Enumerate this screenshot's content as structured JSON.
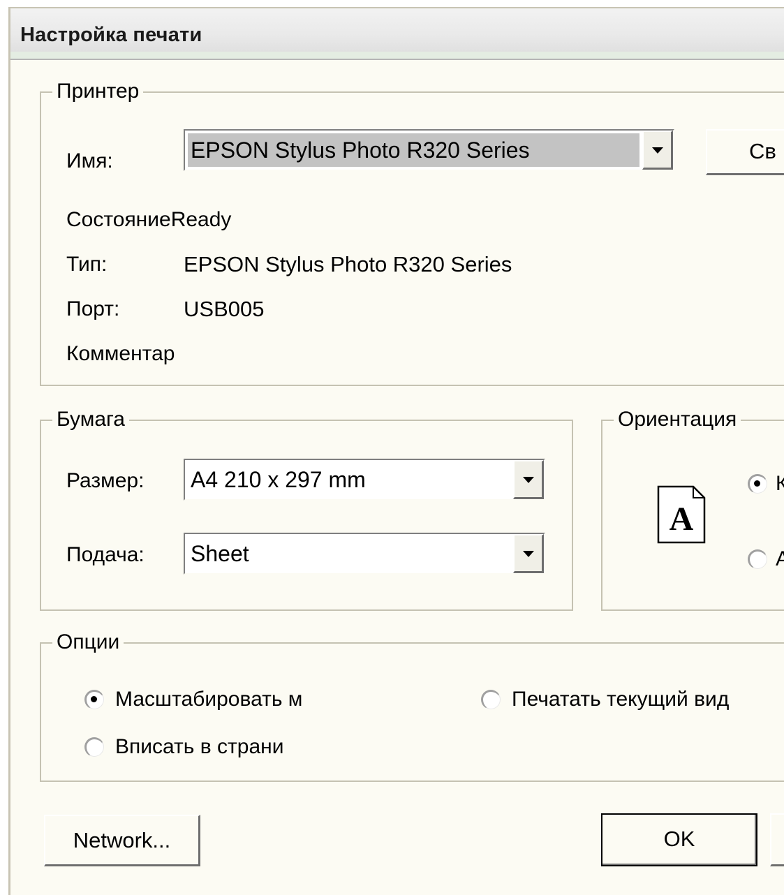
{
  "window": {
    "title": "Настройка печати"
  },
  "printer": {
    "group_label": "Принтер",
    "name_label": "Имя:",
    "name_value": "EPSON Stylus Photo R320 Series",
    "properties_button": "Св",
    "status_label": "Состояние",
    "status_value": "Ready",
    "type_label": "Тип:",
    "type_value": "EPSON Stylus Photo R320 Series",
    "port_label": "Порт:",
    "port_value": "USB005",
    "comment_label": "Комментар"
  },
  "paper": {
    "group_label": "Бумага",
    "size_label": "Размер:",
    "size_value": "A4 210 x 297 mm",
    "source_label": "Подача:",
    "source_value": "Sheet"
  },
  "orientation": {
    "group_label": "Ориентация",
    "page_icon_letter": "A",
    "portrait_label": "К",
    "portrait_selected": true,
    "landscape_label": "А",
    "landscape_selected": false
  },
  "options": {
    "group_label": "Опции",
    "scale_label": "Масштабировать м",
    "scale_selected": true,
    "fit_label": "Вписать в страни",
    "fit_selected": false,
    "current_view_label": "Печатать текущий вид",
    "current_view_selected": false
  },
  "buttons": {
    "network": "Network...",
    "ok": "OK"
  },
  "colors": {
    "dialog_bg": "#fcfbf3",
    "group_border": "#c5c2b2",
    "selection_gray": "#c3c3c3"
  }
}
